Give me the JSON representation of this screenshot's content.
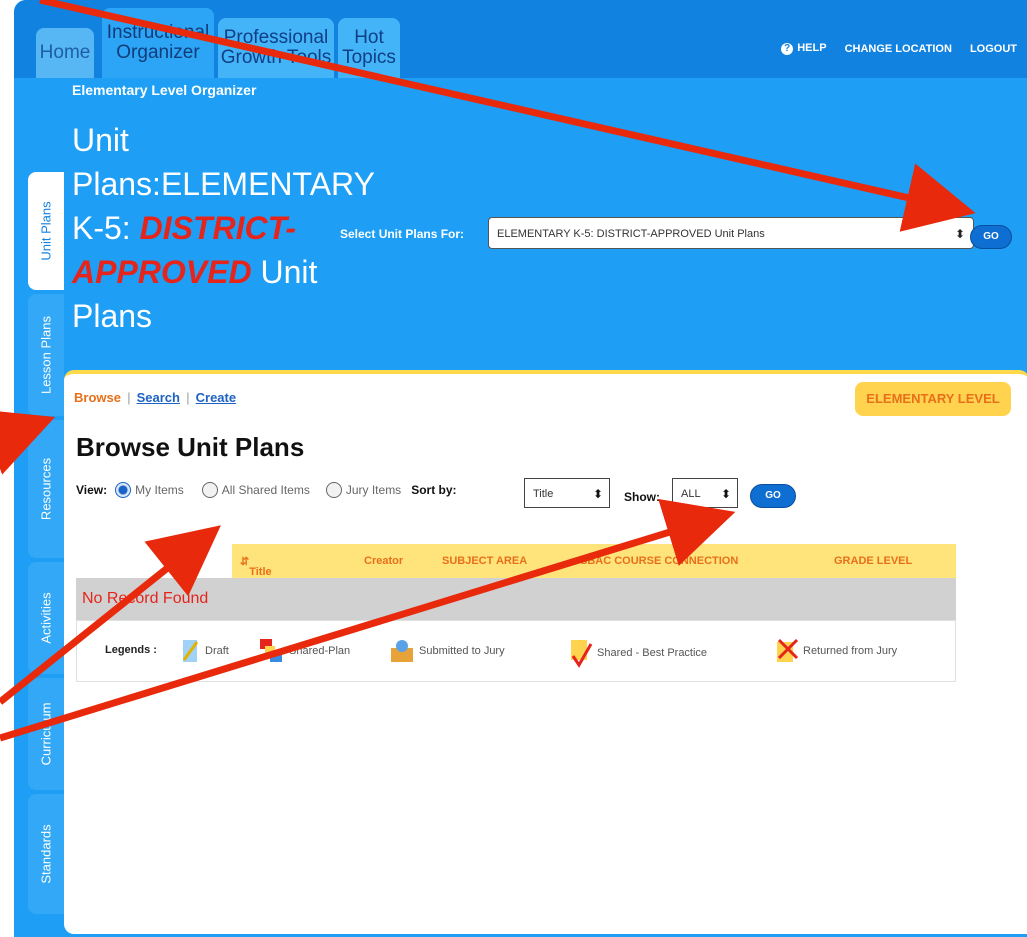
{
  "nav": {
    "home": "Home",
    "instructional": "Instructional Organizer",
    "professional": "Professional Growth Tools",
    "hot": "Hot Topics",
    "help": "HELP",
    "change_location": "CHANGE LOCATION",
    "logout": "LOGOUT"
  },
  "subtitle": "Elementary Level Organizer",
  "page_heading": {
    "part1": "Unit Plans:ELEMENTARY K-5: ",
    "red": "DISTRICT-APPROVED",
    "part2": " Unit Plans"
  },
  "unit_select": {
    "label": "Select Unit Plans For:",
    "value": "ELEMENTARY K-5: DISTRICT-APPROVED Unit Plans",
    "go": "GO"
  },
  "side_tabs": [
    "Unit Plans",
    "Lesson Plans",
    "Resources",
    "Activities",
    "Curriculum",
    "Standards"
  ],
  "breadcrumbs": {
    "browse": "Browse",
    "search": "Search",
    "create": "Create"
  },
  "level_badge": "ELEMENTARY LEVEL",
  "browse_title": "Browse Unit Plans",
  "filters": {
    "view_label": "View:",
    "my_items": "My Items",
    "all_shared": "All Shared Items",
    "jury": "Jury Items",
    "sort_label": "Sort by:",
    "sort_value": "Title",
    "show_label": "Show:",
    "show_value": "ALL",
    "go": "GO"
  },
  "table": {
    "columns": [
      "Title",
      "Creator",
      "SUBJECT AREA",
      "SBAC COURSE CONNECTION",
      "GRADE LEVEL"
    ],
    "empty": "No Record Found"
  },
  "legend": {
    "label": "Legends :",
    "items": [
      "Draft",
      "Shared-Plan",
      "Submitted to Jury",
      "Shared - Best Practice",
      "Returned from Jury"
    ]
  },
  "colors": {
    "accent": "#1e9ff5",
    "highlight": "#ffd34e",
    "alert": "#e5241c",
    "annotation": "#e8290b"
  }
}
